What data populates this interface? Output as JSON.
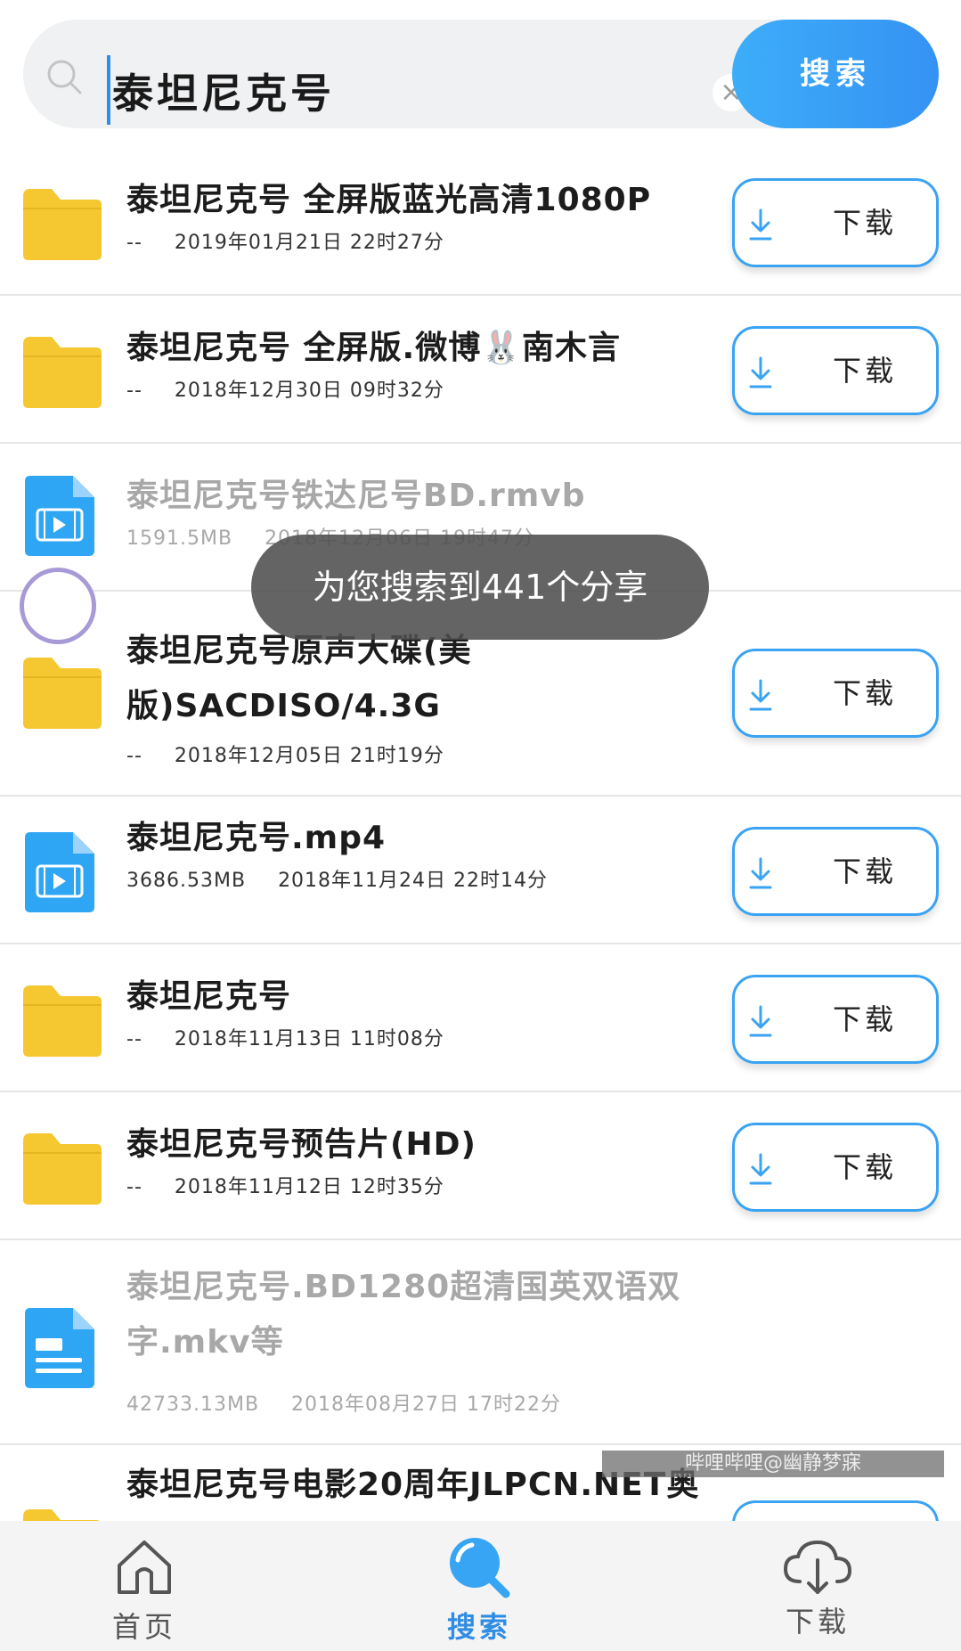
{
  "search": {
    "query": "泰坦尼克号",
    "button_label": "搜索",
    "clear_label": "×"
  },
  "toast": "为您搜索到441个分享",
  "download_label": "下载",
  "results": [
    {
      "type": "folder",
      "title": "泰坦尼克号 全屏版蓝光高清1080P",
      "size": "--",
      "date": "2019年01月21日 22时27分",
      "dimmed": false,
      "has_download": true
    },
    {
      "type": "folder",
      "title": "泰坦尼克号 全屏版.微博🐰南木言",
      "size": "--",
      "date": "2018年12月30日 09时32分",
      "dimmed": false,
      "has_download": true
    },
    {
      "type": "video",
      "title": "泰坦尼克号铁达尼号BD.rmvb",
      "size": "1591.5MB",
      "date": "2018年12月06日 19时47分",
      "dimmed": true,
      "has_download": false
    },
    {
      "type": "folder",
      "title": "泰坦尼克号原声大碟(美版)SACDISO/4.3G",
      "size": "--",
      "date": "2018年12月05日 21时19分",
      "dimmed": false,
      "has_download": true
    },
    {
      "type": "video",
      "title": "泰坦尼克号.mp4",
      "size": "3686.53MB",
      "date": "2018年11月24日 22时14分",
      "dimmed": false,
      "has_download": true
    },
    {
      "type": "folder",
      "title": "泰坦尼克号",
      "size": "--",
      "date": "2018年11月13日 11时08分",
      "dimmed": false,
      "has_download": true
    },
    {
      "type": "folder",
      "title": "泰坦尼克号预告片(HD)",
      "size": "--",
      "date": "2018年11月12日 12时35分",
      "dimmed": false,
      "has_download": true
    },
    {
      "type": "document",
      "title": "泰坦尼克号.BD1280超清国英双语双字.mkv等",
      "size": "42733.13MB",
      "date": "2018年08月27日 17时22分",
      "dimmed": true,
      "has_download": false
    },
    {
      "type": "folder",
      "title": "泰坦尼克号电影20周年JLPCN.NET奥",
      "size": "",
      "date": "",
      "dimmed": false,
      "has_download": true
    }
  ],
  "watermark": "哔哩哔哩@幽静梦寐",
  "nav": {
    "home": "首页",
    "search": "搜索",
    "download": "下载"
  },
  "colors": {
    "accent": "#3592f3",
    "folder": "#f5c832",
    "file": "#2ea6f4"
  },
  "icons": {
    "folder": "folder-icon",
    "video": "video-file-icon",
    "document": "document-file-icon",
    "download": "download-arrow-icon"
  }
}
